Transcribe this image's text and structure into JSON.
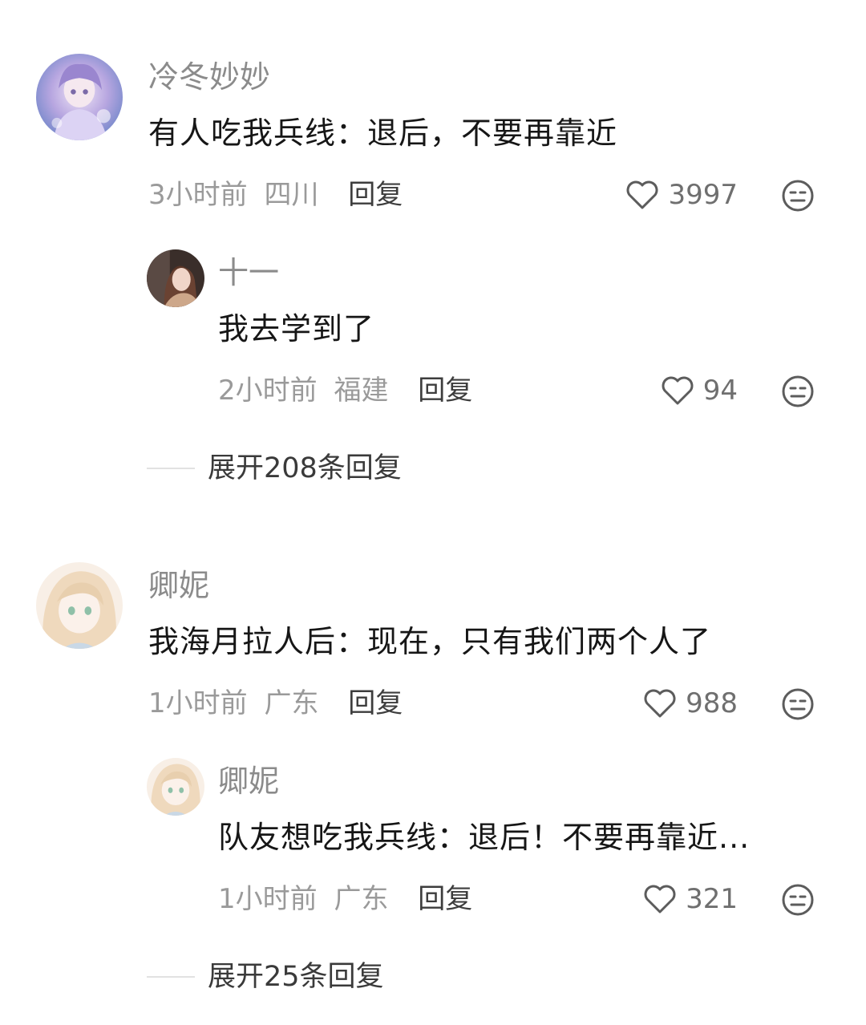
{
  "comments": [
    {
      "username": "冷冬妙妙",
      "content": "有人吃我兵线：退后，不要再靠近",
      "time": "3小时前",
      "location": "四川",
      "reply_label": "回复",
      "likes": "3997",
      "replies": [
        {
          "username": "十一",
          "content": "我去学到了",
          "time": "2小时前",
          "location": "福建",
          "reply_label": "回复",
          "likes": "94"
        }
      ],
      "expand_label": "展开208条回复"
    },
    {
      "username": "卿妮",
      "content": "我海月拉人后：现在，只有我们两个人了",
      "time": "1小时前",
      "location": "广东",
      "reply_label": "回复",
      "likes": "988",
      "replies": [
        {
          "username": "卿妮",
          "content": "队友想吃我兵线：退后！不要再靠近...",
          "time": "1小时前",
          "location": "广东",
          "reply_label": "回复",
          "likes": "321"
        }
      ],
      "expand_label": "展开25条回复"
    }
  ],
  "icons": {
    "like": "heart-outline-icon",
    "dislike": "unamused-face-icon"
  },
  "colors": {
    "username": "#8b8b8b",
    "content": "#161616",
    "meta": "#9a9a9a",
    "reply": "#3d3d3d"
  }
}
